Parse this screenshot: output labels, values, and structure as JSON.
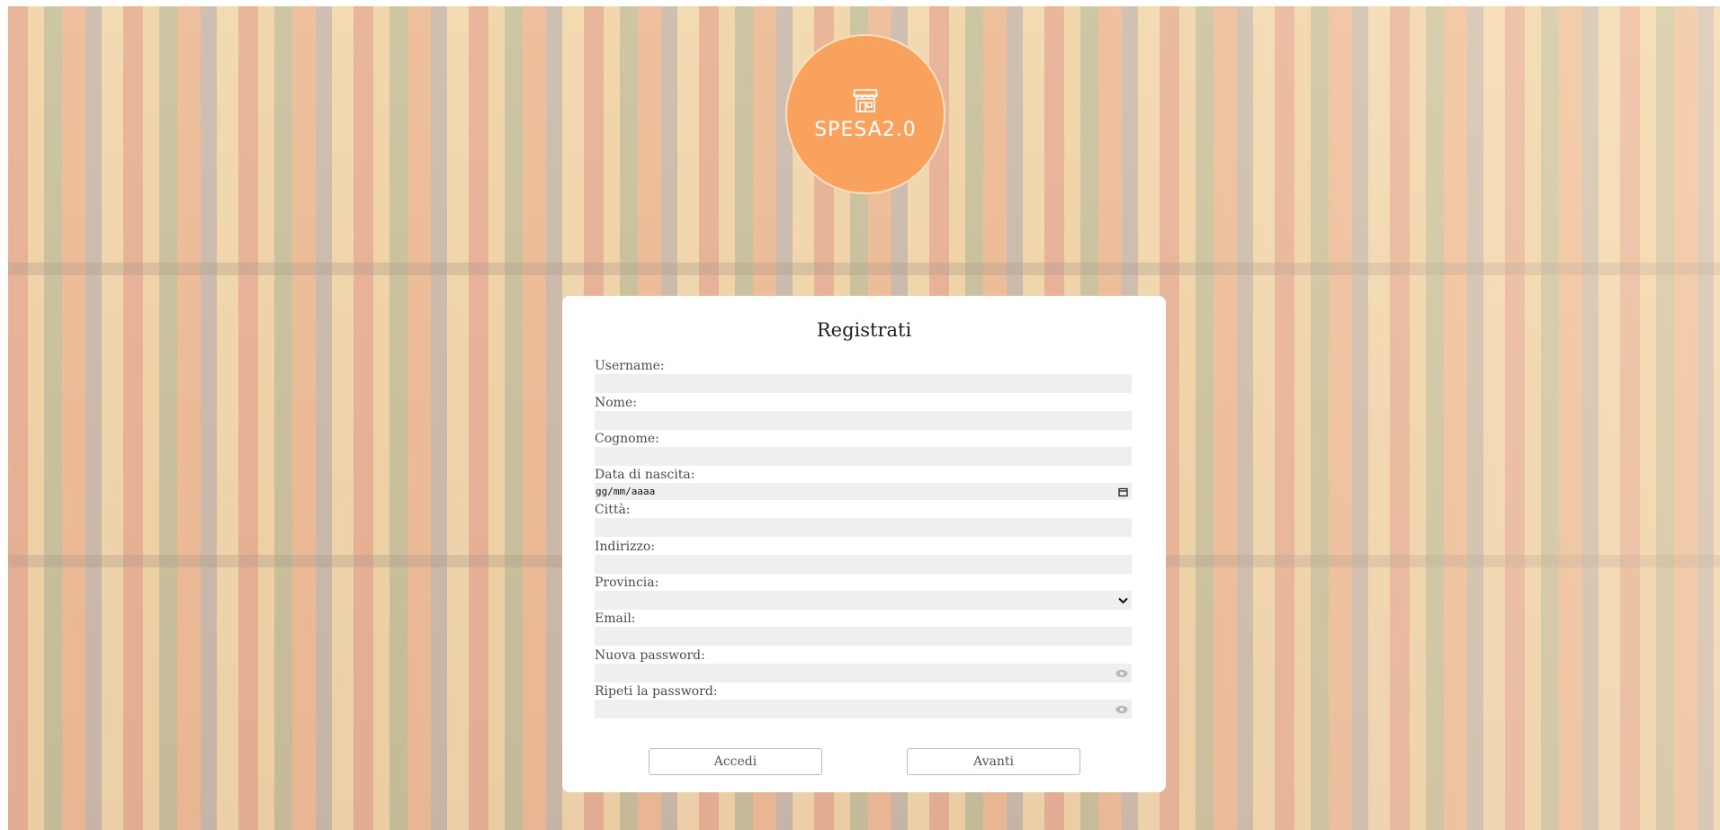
{
  "brand": {
    "logo_text": "SPESA2.0",
    "logo_color": "#f9a25e"
  },
  "form": {
    "title": "Registrati",
    "fields": {
      "username": {
        "label": "Username:"
      },
      "nome": {
        "label": "Nome:"
      },
      "cognome": {
        "label": "Cognome:"
      },
      "data_nascita": {
        "label": "Data di nascita:",
        "placeholder": "gg/mm/aaaa"
      },
      "citta": {
        "label": "Città:"
      },
      "indirizzo": {
        "label": "Indirizzo:"
      },
      "provincia": {
        "label": "Provincia:"
      },
      "email": {
        "label": "Email:"
      },
      "nuova_password": {
        "label": "Nuova password:"
      },
      "ripeti_password": {
        "label": "Ripeti la password:"
      }
    },
    "buttons": {
      "accedi": "Accedi",
      "avanti": "Avanti"
    }
  },
  "icons": {
    "logo": "store-icon",
    "date": "calendar-icon",
    "select": "chevron-down-icon",
    "password": "eye-icon"
  }
}
